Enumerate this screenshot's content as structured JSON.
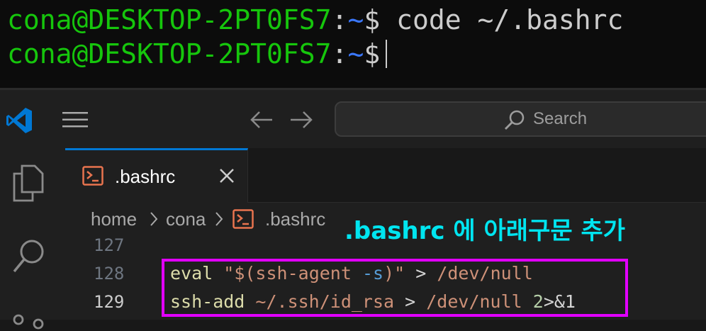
{
  "terminal": {
    "lines": [
      {
        "user": "cona@DESKTOP-2PT0FS7",
        "colon": ":",
        "path": "~",
        "dollar": "$",
        "command": " code ~/.bashrc"
      },
      {
        "user": "cona@DESKTOP-2PT0FS7",
        "colon": ":",
        "path": "~",
        "dollar": "$",
        "command": ""
      }
    ]
  },
  "titlebar": {
    "search_placeholder": "Search"
  },
  "tab": {
    "label": ".bashrc"
  },
  "breadcrumb": {
    "home": "home",
    "cona": "cona",
    "file": ".bashrc"
  },
  "editor": {
    "line_numbers": [
      "127",
      "128",
      "129"
    ],
    "line128": {
      "fn": "eval",
      "str_open": "\"$(ssh-agent ",
      "flag": "-s",
      "str_close": ")\"",
      "redirect": " > ",
      "target": "/dev/null"
    },
    "line129": {
      "fn": "ssh-add",
      "args": " ~/.ssh/id_rsa",
      "redirect": " > ",
      "target": "/dev/null",
      "num": " 2",
      "tail": ">&1"
    }
  },
  "annotation": {
    "text": ".bashrc 에 아래구문 추가"
  },
  "colors": {
    "terminal_user": "#16c60c",
    "terminal_path": "#3b78ff",
    "highlight_border": "#e100ff",
    "annotation": "#00e5f0",
    "file_icon": "#e8744f",
    "accent": "#0078d4"
  },
  "icons": {
    "app": "vscode-logo",
    "menu": "hamburger-menu-icon",
    "back": "arrow-left-icon",
    "forward": "arrow-right-icon",
    "search": "search-icon",
    "explorer": "files-icon",
    "search_view": "magnifier-icon",
    "source_control": "source-control-icon",
    "close": "close-icon",
    "file": "terminal-file-icon"
  }
}
